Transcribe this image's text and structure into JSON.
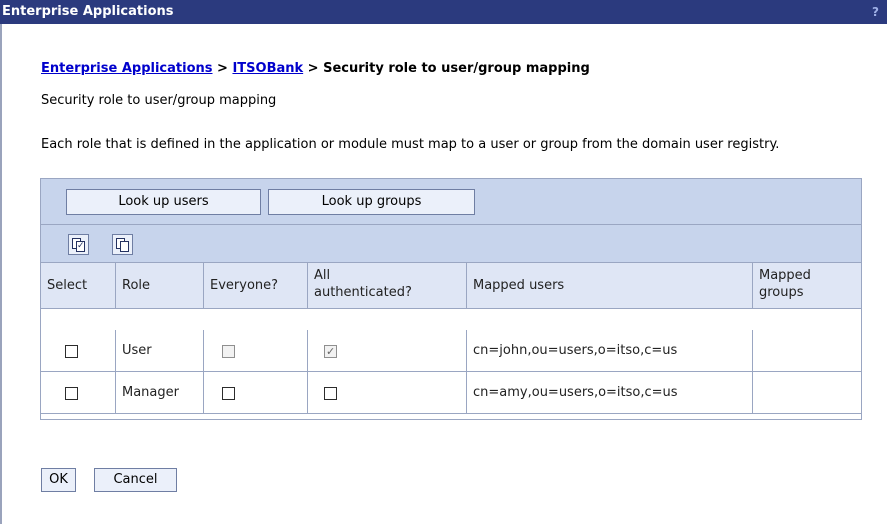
{
  "titlebar": {
    "title": "Enterprise Applications",
    "help_glyph": "?"
  },
  "breadcrumb": {
    "link1": "Enterprise Applications",
    "sep1": " > ",
    "link2": "ITSOBank",
    "sep2": " > ",
    "current": "Security role to user/group mapping"
  },
  "subtitle": "Security role to user/group mapping",
  "description": "Each role that is defined in the application or module must map to a user or group from the domain user registry.",
  "buttons": {
    "lookup_users": "Look up users",
    "lookup_groups": "Look up groups",
    "ok": "OK",
    "cancel": "Cancel"
  },
  "icons": [
    "select-all-icon",
    "deselect-all-icon"
  ],
  "table": {
    "headers": {
      "select": "Select",
      "role": "Role",
      "everyone": "Everyone?",
      "all_auth_line1": "All",
      "all_auth_line2": "authenticated?",
      "mapped_users": "Mapped users",
      "mapped_groups_line1": "Mapped",
      "mapped_groups_line2": "groups"
    },
    "rows": [
      {
        "role": "User",
        "select": false,
        "everyone": false,
        "everyone_disabled": true,
        "all_authenticated": true,
        "all_authenticated_disabled": true,
        "mapped_users": "cn=john,ou=users,o=itso,c=us",
        "mapped_groups": ""
      },
      {
        "role": "Manager",
        "select": false,
        "everyone": false,
        "everyone_disabled": false,
        "all_authenticated": false,
        "all_authenticated_disabled": false,
        "mapped_users": "cn=amy,ou=users,o=itso,c=us",
        "mapped_groups": ""
      }
    ]
  },
  "colors": {
    "titlebar": "#2b3a7e",
    "toolbar": "#c7d4ec",
    "header_row": "#dfe6f5",
    "button_face": "#ebf0fa",
    "link": "#0000cc"
  }
}
